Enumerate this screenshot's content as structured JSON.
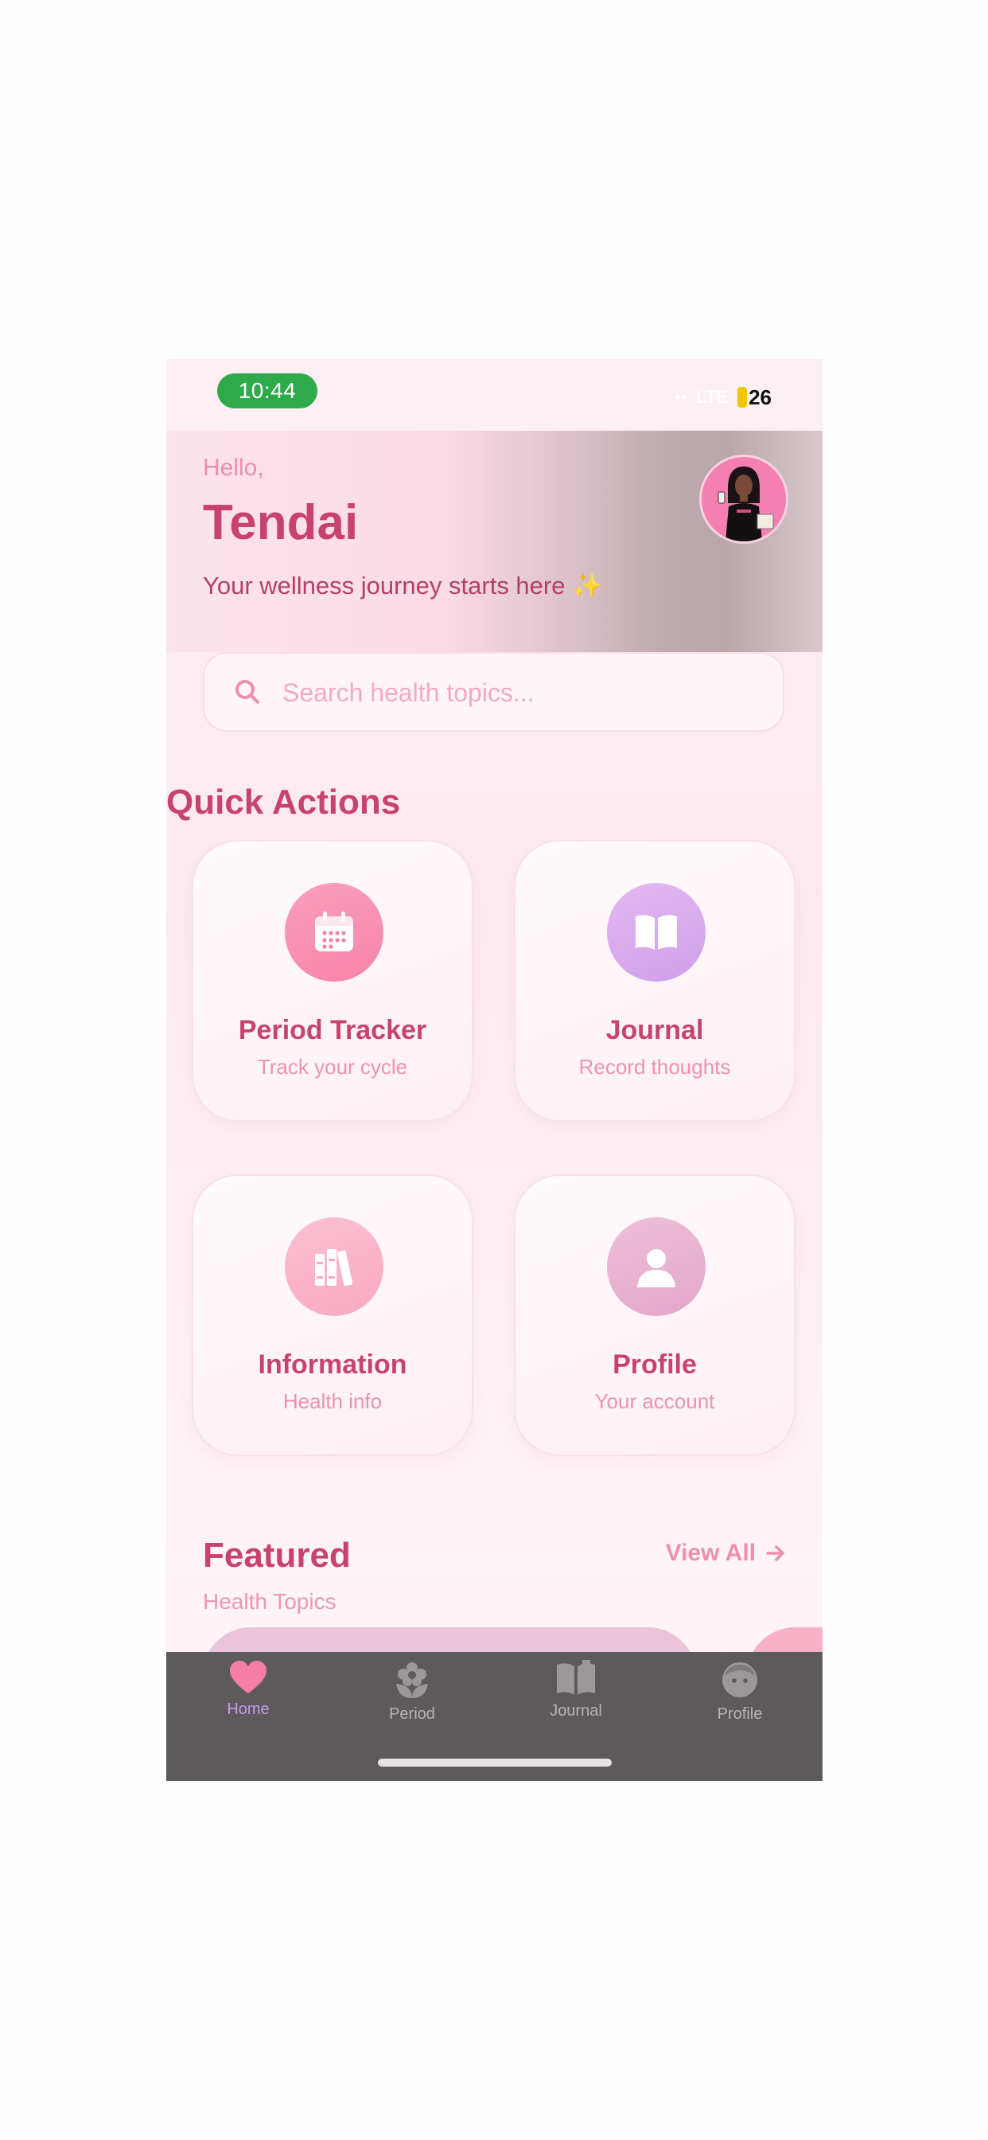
{
  "status_bar": {
    "time": "10:44",
    "signal": "••",
    "network": "LTE",
    "battery": "26"
  },
  "header": {
    "greeting": "Hello,",
    "name": "Tendai",
    "tagline": "Your wellness journey starts here ✨"
  },
  "search": {
    "placeholder": "Search health topics..."
  },
  "quick_actions": {
    "title": "Quick Actions",
    "items": [
      {
        "title": "Period Tracker",
        "subtitle": "Track your cycle",
        "icon": "calendar-icon",
        "color": "#f98fb2"
      },
      {
        "title": "Journal",
        "subtitle": "Record thoughts",
        "icon": "open-book-icon",
        "color": "#d7a8ee"
      },
      {
        "title": "Information",
        "subtitle": "Health info",
        "icon": "books-icon",
        "color": "#f9b3c9"
      },
      {
        "title": "Profile",
        "subtitle": "Your account",
        "icon": "person-icon",
        "color": "#e7b3d2"
      }
    ]
  },
  "featured": {
    "title": "Featured",
    "subtitle": "Health Topics",
    "view_all": "View All"
  },
  "tab_bar": {
    "items": [
      {
        "label": "Home",
        "icon": "heart-icon",
        "active": true
      },
      {
        "label": "Period",
        "icon": "flower-icon",
        "active": false
      },
      {
        "label": "Journal",
        "icon": "book-icon",
        "active": false
      },
      {
        "label": "Profile",
        "icon": "face-icon",
        "active": false
      }
    ]
  },
  "colors": {
    "accent": "#c8426f",
    "active_tab": "#c79ae8",
    "tab_bar_bg": "#5d5a5c"
  }
}
